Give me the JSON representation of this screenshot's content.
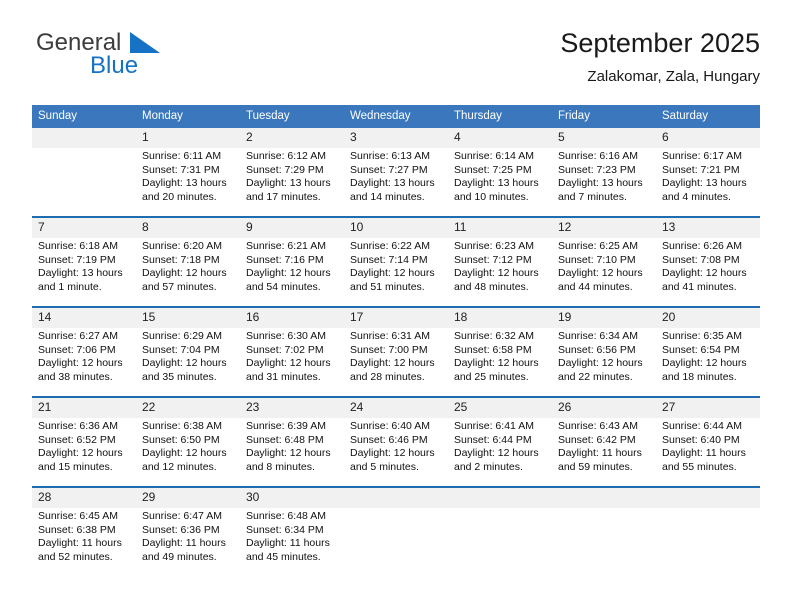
{
  "brand": {
    "name_primary": "General",
    "name_secondary": "Blue",
    "triangle_color": "#1572c4",
    "primary_color": "#3c3c3c"
  },
  "header": {
    "title": "September 2025",
    "subtitle": "Zalakomar, Zala, Hungary",
    "accent_color": "#3a77bd",
    "separator_color": "#1f6cb0",
    "daynum_band_color": "#f1f1f1"
  },
  "columns": [
    "Sunday",
    "Monday",
    "Tuesday",
    "Wednesday",
    "Thursday",
    "Friday",
    "Saturday"
  ],
  "weeks": [
    {
      "days": [
        {
          "num": "",
          "sunrise": "",
          "sunset": "",
          "daylight": "",
          "daylight2": ""
        },
        {
          "num": "1",
          "sunrise": "Sunrise: 6:11 AM",
          "sunset": "Sunset: 7:31 PM",
          "daylight": "Daylight: 13 hours",
          "daylight2": "and 20 minutes."
        },
        {
          "num": "2",
          "sunrise": "Sunrise: 6:12 AM",
          "sunset": "Sunset: 7:29 PM",
          "daylight": "Daylight: 13 hours",
          "daylight2": "and 17 minutes."
        },
        {
          "num": "3",
          "sunrise": "Sunrise: 6:13 AM",
          "sunset": "Sunset: 7:27 PM",
          "daylight": "Daylight: 13 hours",
          "daylight2": "and 14 minutes."
        },
        {
          "num": "4",
          "sunrise": "Sunrise: 6:14 AM",
          "sunset": "Sunset: 7:25 PM",
          "daylight": "Daylight: 13 hours",
          "daylight2": "and 10 minutes."
        },
        {
          "num": "5",
          "sunrise": "Sunrise: 6:16 AM",
          "sunset": "Sunset: 7:23 PM",
          "daylight": "Daylight: 13 hours",
          "daylight2": "and 7 minutes."
        },
        {
          "num": "6",
          "sunrise": "Sunrise: 6:17 AM",
          "sunset": "Sunset: 7:21 PM",
          "daylight": "Daylight: 13 hours",
          "daylight2": "and 4 minutes."
        }
      ]
    },
    {
      "days": [
        {
          "num": "7",
          "sunrise": "Sunrise: 6:18 AM",
          "sunset": "Sunset: 7:19 PM",
          "daylight": "Daylight: 13 hours",
          "daylight2": "and 1 minute."
        },
        {
          "num": "8",
          "sunrise": "Sunrise: 6:20 AM",
          "sunset": "Sunset: 7:18 PM",
          "daylight": "Daylight: 12 hours",
          "daylight2": "and 57 minutes."
        },
        {
          "num": "9",
          "sunrise": "Sunrise: 6:21 AM",
          "sunset": "Sunset: 7:16 PM",
          "daylight": "Daylight: 12 hours",
          "daylight2": "and 54 minutes."
        },
        {
          "num": "10",
          "sunrise": "Sunrise: 6:22 AM",
          "sunset": "Sunset: 7:14 PM",
          "daylight": "Daylight: 12 hours",
          "daylight2": "and 51 minutes."
        },
        {
          "num": "11",
          "sunrise": "Sunrise: 6:23 AM",
          "sunset": "Sunset: 7:12 PM",
          "daylight": "Daylight: 12 hours",
          "daylight2": "and 48 minutes."
        },
        {
          "num": "12",
          "sunrise": "Sunrise: 6:25 AM",
          "sunset": "Sunset: 7:10 PM",
          "daylight": "Daylight: 12 hours",
          "daylight2": "and 44 minutes."
        },
        {
          "num": "13",
          "sunrise": "Sunrise: 6:26 AM",
          "sunset": "Sunset: 7:08 PM",
          "daylight": "Daylight: 12 hours",
          "daylight2": "and 41 minutes."
        }
      ]
    },
    {
      "days": [
        {
          "num": "14",
          "sunrise": "Sunrise: 6:27 AM",
          "sunset": "Sunset: 7:06 PM",
          "daylight": "Daylight: 12 hours",
          "daylight2": "and 38 minutes."
        },
        {
          "num": "15",
          "sunrise": "Sunrise: 6:29 AM",
          "sunset": "Sunset: 7:04 PM",
          "daylight": "Daylight: 12 hours",
          "daylight2": "and 35 minutes."
        },
        {
          "num": "16",
          "sunrise": "Sunrise: 6:30 AM",
          "sunset": "Sunset: 7:02 PM",
          "daylight": "Daylight: 12 hours",
          "daylight2": "and 31 minutes."
        },
        {
          "num": "17",
          "sunrise": "Sunrise: 6:31 AM",
          "sunset": "Sunset: 7:00 PM",
          "daylight": "Daylight: 12 hours",
          "daylight2": "and 28 minutes."
        },
        {
          "num": "18",
          "sunrise": "Sunrise: 6:32 AM",
          "sunset": "Sunset: 6:58 PM",
          "daylight": "Daylight: 12 hours",
          "daylight2": "and 25 minutes."
        },
        {
          "num": "19",
          "sunrise": "Sunrise: 6:34 AM",
          "sunset": "Sunset: 6:56 PM",
          "daylight": "Daylight: 12 hours",
          "daylight2": "and 22 minutes."
        },
        {
          "num": "20",
          "sunrise": "Sunrise: 6:35 AM",
          "sunset": "Sunset: 6:54 PM",
          "daylight": "Daylight: 12 hours",
          "daylight2": "and 18 minutes."
        }
      ]
    },
    {
      "days": [
        {
          "num": "21",
          "sunrise": "Sunrise: 6:36 AM",
          "sunset": "Sunset: 6:52 PM",
          "daylight": "Daylight: 12 hours",
          "daylight2": "and 15 minutes."
        },
        {
          "num": "22",
          "sunrise": "Sunrise: 6:38 AM",
          "sunset": "Sunset: 6:50 PM",
          "daylight": "Daylight: 12 hours",
          "daylight2": "and 12 minutes."
        },
        {
          "num": "23",
          "sunrise": "Sunrise: 6:39 AM",
          "sunset": "Sunset: 6:48 PM",
          "daylight": "Daylight: 12 hours",
          "daylight2": "and 8 minutes."
        },
        {
          "num": "24",
          "sunrise": "Sunrise: 6:40 AM",
          "sunset": "Sunset: 6:46 PM",
          "daylight": "Daylight: 12 hours",
          "daylight2": "and 5 minutes."
        },
        {
          "num": "25",
          "sunrise": "Sunrise: 6:41 AM",
          "sunset": "Sunset: 6:44 PM",
          "daylight": "Daylight: 12 hours",
          "daylight2": "and 2 minutes."
        },
        {
          "num": "26",
          "sunrise": "Sunrise: 6:43 AM",
          "sunset": "Sunset: 6:42 PM",
          "daylight": "Daylight: 11 hours",
          "daylight2": "and 59 minutes."
        },
        {
          "num": "27",
          "sunrise": "Sunrise: 6:44 AM",
          "sunset": "Sunset: 6:40 PM",
          "daylight": "Daylight: 11 hours",
          "daylight2": "and 55 minutes."
        }
      ]
    },
    {
      "days": [
        {
          "num": "28",
          "sunrise": "Sunrise: 6:45 AM",
          "sunset": "Sunset: 6:38 PM",
          "daylight": "Daylight: 11 hours",
          "daylight2": "and 52 minutes."
        },
        {
          "num": "29",
          "sunrise": "Sunrise: 6:47 AM",
          "sunset": "Sunset: 6:36 PM",
          "daylight": "Daylight: 11 hours",
          "daylight2": "and 49 minutes."
        },
        {
          "num": "30",
          "sunrise": "Sunrise: 6:48 AM",
          "sunset": "Sunset: 6:34 PM",
          "daylight": "Daylight: 11 hours",
          "daylight2": "and 45 minutes."
        },
        {
          "num": "",
          "sunrise": "",
          "sunset": "",
          "daylight": "",
          "daylight2": ""
        },
        {
          "num": "",
          "sunrise": "",
          "sunset": "",
          "daylight": "",
          "daylight2": ""
        },
        {
          "num": "",
          "sunrise": "",
          "sunset": "",
          "daylight": "",
          "daylight2": ""
        },
        {
          "num": "",
          "sunrise": "",
          "sunset": "",
          "daylight": "",
          "daylight2": ""
        }
      ]
    }
  ]
}
